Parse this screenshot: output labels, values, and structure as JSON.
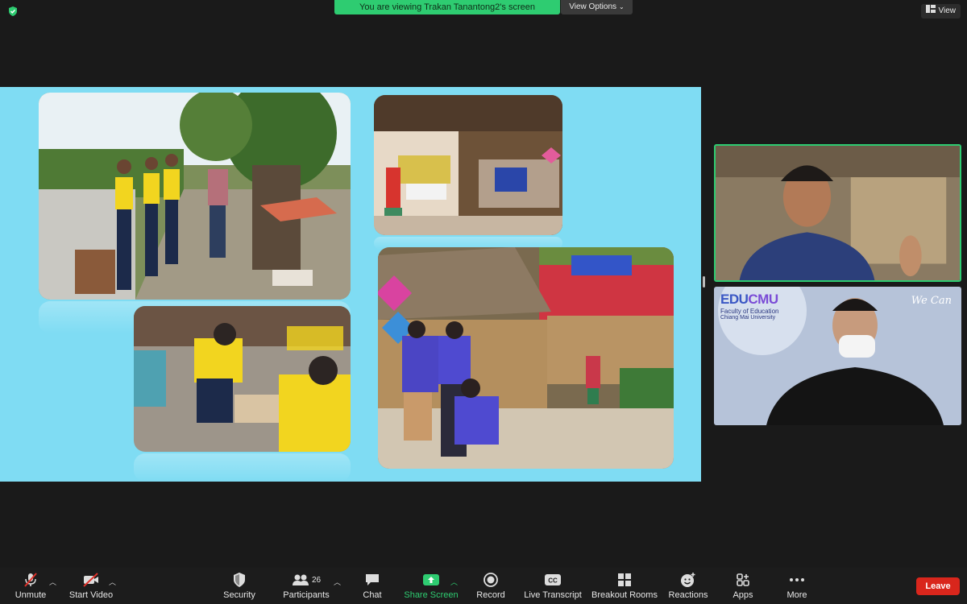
{
  "banner": {
    "text": "You are viewing Trakan Tanantong2's screen",
    "view_options": "View Options"
  },
  "view_button": "View",
  "participants": [
    {
      "tile": "speaker"
    },
    {
      "tile": "presenter",
      "logo_main_1": "EDU",
      "logo_main_2": "CMU",
      "logo_sub_1": "Faculty of Education",
      "logo_sub_2": "Chiang Mai University",
      "watermark": "We Can"
    }
  ],
  "toolbar": {
    "unmute": "Unmute",
    "start_video": "Start Video",
    "security": "Security",
    "participants": "Participants",
    "participants_count": "26",
    "chat": "Chat",
    "share_screen": "Share Screen",
    "record": "Record",
    "live_transcript": "Live Transcript",
    "breakout_rooms": "Breakout Rooms",
    "reactions": "Reactions",
    "apps": "Apps",
    "more": "More",
    "leave": "Leave"
  },
  "colors": {
    "accent": "#2ecc71",
    "leave": "#d9261c",
    "stage": "#7fdcf3",
    "background": "#1a1a1a"
  }
}
